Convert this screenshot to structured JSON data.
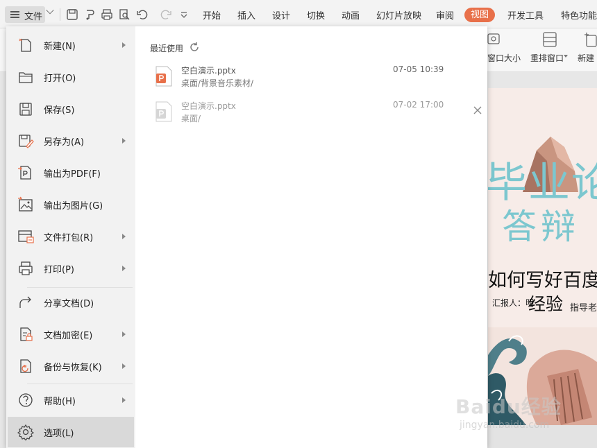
{
  "menubar": {
    "file_label": "文件",
    "tabs": [
      "开始",
      "插入",
      "设计",
      "切换",
      "动画",
      "幻灯片放映",
      "审阅",
      "视图",
      "开发工具",
      "特色功能"
    ]
  },
  "ribbon": {
    "window_size_label": "窗口大小",
    "rearrange_label": "重排窗口",
    "new_label": "新建"
  },
  "file_menu": {
    "items": [
      {
        "label": "新建(N)",
        "icon": "new-file-icon"
      },
      {
        "label": "打开(O)",
        "icon": "open-folder-icon"
      },
      {
        "label": "保存(S)",
        "icon": "save-icon"
      },
      {
        "label": "另存为(A)",
        "icon": "save-as-icon"
      },
      {
        "label": "输出为PDF(F)",
        "icon": "export-pdf-icon"
      },
      {
        "label": "输出为图片(G)",
        "icon": "export-image-icon"
      },
      {
        "label": "文件打包(R)",
        "icon": "package-icon"
      },
      {
        "label": "打印(P)",
        "icon": "print-icon"
      },
      {
        "label": "分享文档(D)",
        "icon": "share-icon"
      },
      {
        "label": "文档加密(E)",
        "icon": "encrypt-icon"
      },
      {
        "label": "备份与恢复(K)",
        "icon": "backup-icon"
      },
      {
        "label": "帮助(H)",
        "icon": "help-icon"
      },
      {
        "label": "选项(L)",
        "icon": "options-gear-icon"
      }
    ],
    "recent_title": "最近使用",
    "recent_files": [
      {
        "name": "空白演示.pptx",
        "path": "桌面/背景音乐素材/",
        "date": "07-05 10:39"
      },
      {
        "name": "空白演示.pptx",
        "path": "桌面/",
        "date": "07-02 17:00"
      }
    ]
  },
  "slide": {
    "line1": "毕业论",
    "line2": "答辩",
    "line3": "如何写好百度",
    "reporter": "汇报人：明",
    "experience": "经验",
    "advisor": "指导老"
  },
  "watermark": {
    "logo": "Baidu经验",
    "url": "jingyan.baidu.com"
  },
  "colors": {
    "accent": "#e8704a",
    "slide_title": "#7cc7cf",
    "pptx_icon": "#e8704a"
  }
}
